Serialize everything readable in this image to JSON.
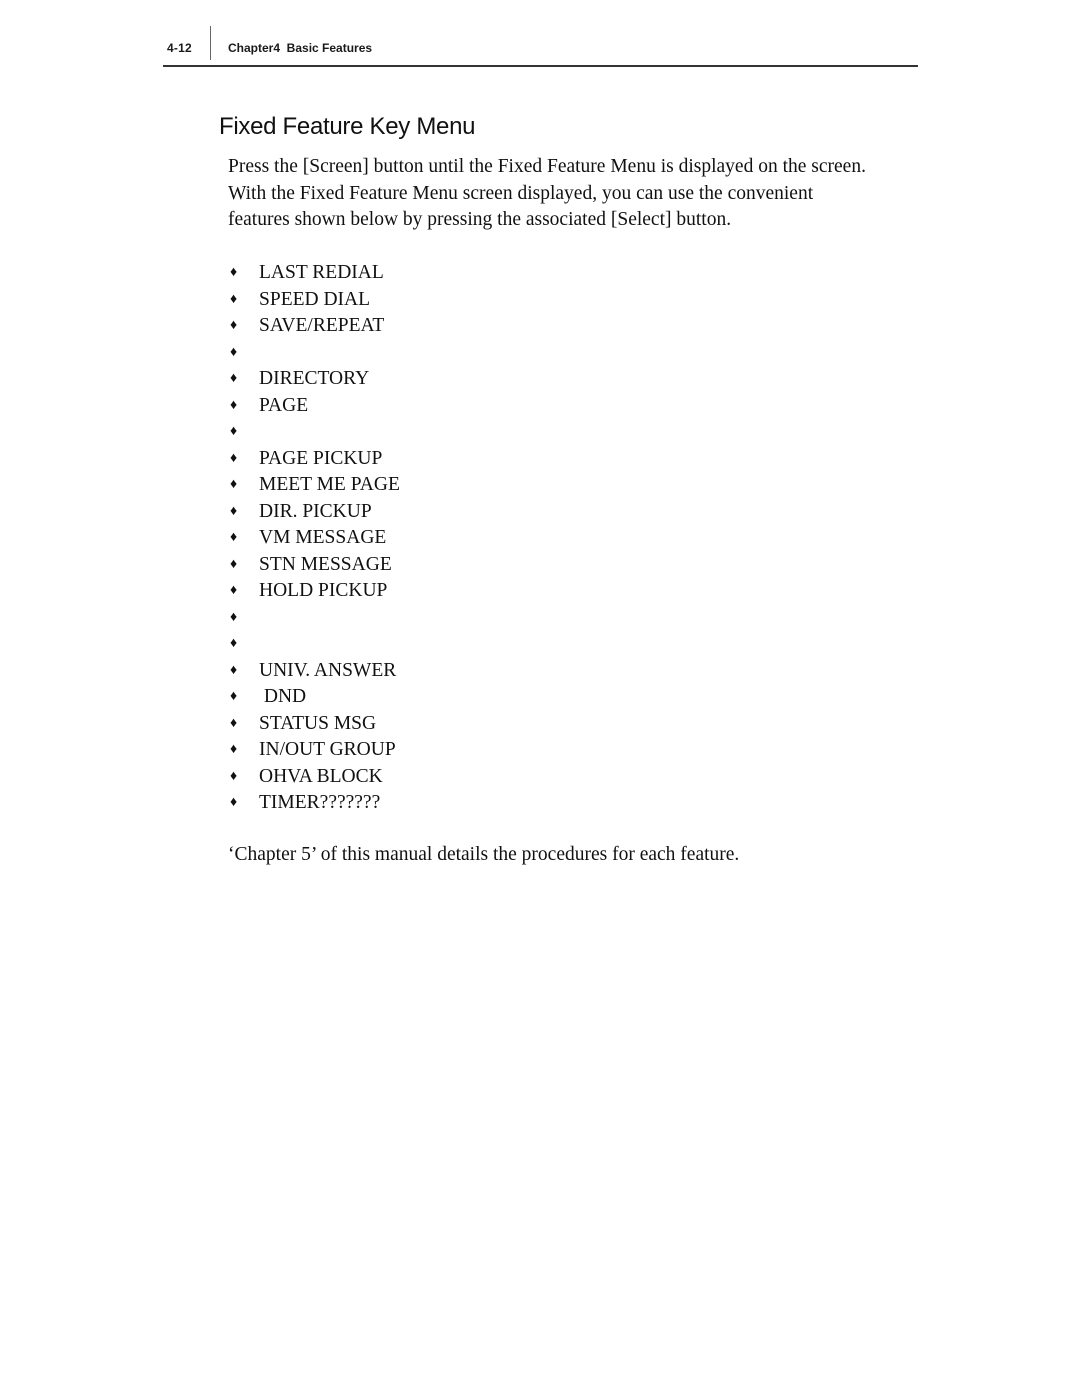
{
  "header": {
    "page_number": "4-12",
    "running_title": "Chapter4  Basic Features"
  },
  "section": {
    "title": "Fixed Feature Key Menu",
    "intro_lines": [
      "Press the [Screen] button until the Fixed Feature Menu is displayed on the screen.",
      "With the Fixed Feature Menu screen displayed, you can use the convenient",
      "features shown below by pressing the associated [Select] button."
    ],
    "bullet_icon": "diamond-bullet-icon",
    "bullet_glyph": "♦",
    "features": [
      {
        "label": "LAST REDIAL"
      },
      {
        "label": "SPEED DIAL"
      },
      {
        "label": "SAVE/REPEAT"
      },
      {
        "label": ""
      },
      {
        "label": "DIRECTORY"
      },
      {
        "label": "PAGE"
      },
      {
        "label": ""
      },
      {
        "label": "PAGE PICKUP"
      },
      {
        "label": "MEET ME PAGE"
      },
      {
        "label": "DIR. PICKUP"
      },
      {
        "label": "VM MESSAGE"
      },
      {
        "label": "STN MESSAGE"
      },
      {
        "label": "HOLD PICKUP"
      },
      {
        "label": ""
      },
      {
        "label": ""
      },
      {
        "label": "UNIV. ANSWER"
      },
      {
        "label": " DND"
      },
      {
        "label": "STATUS MSG"
      },
      {
        "label": "IN/OUT GROUP"
      },
      {
        "label": "OHVA BLOCK"
      },
      {
        "label": "TIMER???????"
      }
    ],
    "outro": "‘Chapter 5’ of this manual details the procedures for each feature."
  }
}
